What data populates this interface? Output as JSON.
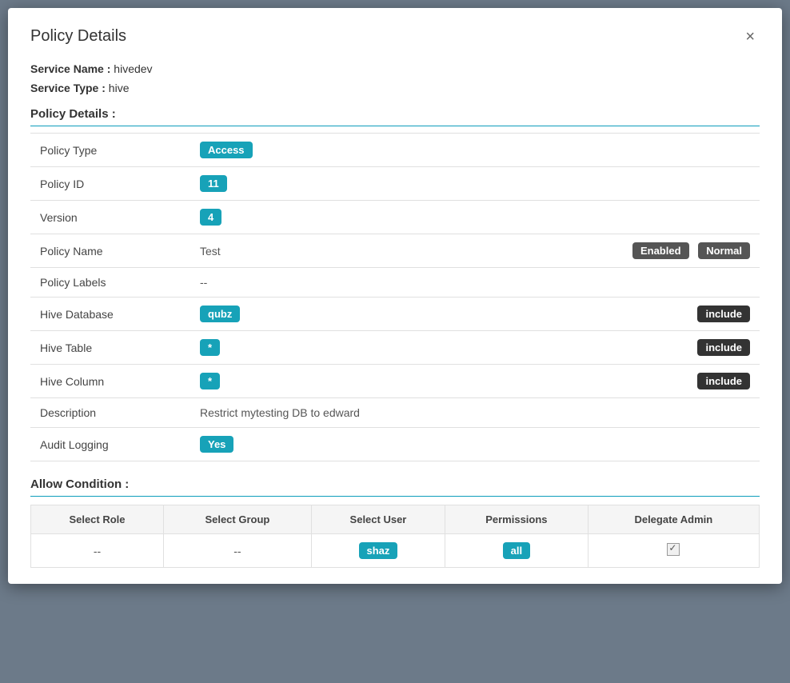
{
  "modal": {
    "title": "Policy Details",
    "close_label": "×"
  },
  "meta": {
    "service_name_label": "Service Name :",
    "service_name_value": "hivedev",
    "service_type_label": "Service Type :",
    "service_type_value": "hive"
  },
  "policy_details_heading": "Policy Details :",
  "rows": [
    {
      "label": "Policy Type",
      "value": "Access",
      "badge": "teal",
      "right_badge": null,
      "right_badge2": null
    },
    {
      "label": "Policy ID",
      "value": "11",
      "badge": "teal",
      "right_badge": null,
      "right_badge2": null
    },
    {
      "label": "Version",
      "value": "4",
      "badge": "teal",
      "right_badge": null,
      "right_badge2": null
    },
    {
      "label": "Policy Name",
      "value": "Test",
      "badge": null,
      "right_badge": "Enabled",
      "right_badge2": "Normal"
    },
    {
      "label": "Policy Labels",
      "value": "--",
      "badge": null,
      "right_badge": null,
      "right_badge2": null
    },
    {
      "label": "Hive Database",
      "value": "qubz",
      "badge": "teal",
      "right_badge": "include",
      "right_badge2": null
    },
    {
      "label": "Hive Table",
      "value": "*",
      "badge": "teal",
      "right_badge": "include",
      "right_badge2": null
    },
    {
      "label": "Hive Column",
      "value": "*",
      "badge": "teal",
      "right_badge": "include",
      "right_badge2": null
    },
    {
      "label": "Description",
      "value": "Restrict mytesting DB to edward",
      "badge": null,
      "right_badge": null,
      "right_badge2": null
    },
    {
      "label": "Audit Logging",
      "value": "Yes",
      "badge": "yes",
      "right_badge": null,
      "right_badge2": null
    }
  ],
  "allow_condition_heading": "Allow Condition :",
  "allow_table": {
    "headers": [
      "Select Role",
      "Select Group",
      "Select User",
      "Permissions",
      "Delegate Admin"
    ],
    "rows": [
      {
        "role": "--",
        "group": "--",
        "user": "shaz",
        "user_badge": "teal",
        "permissions": "all",
        "permissions_badge": "teal",
        "delegate_admin": true
      }
    ]
  }
}
